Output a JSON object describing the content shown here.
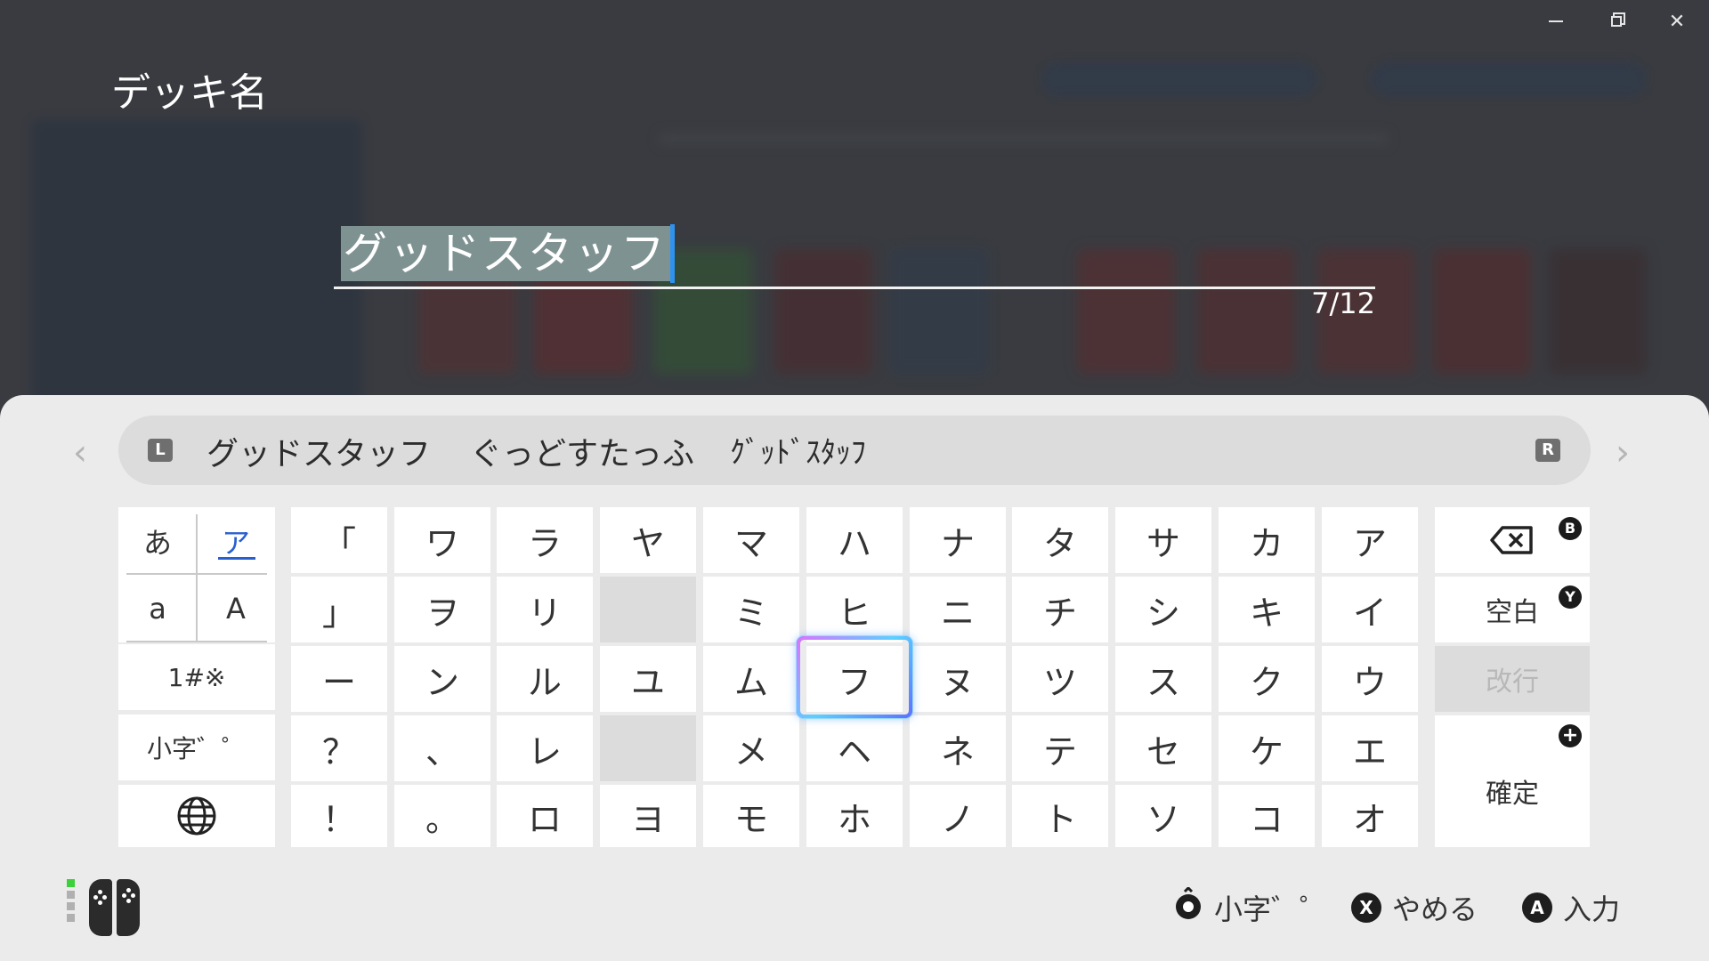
{
  "window": {
    "minimize_label": "minimize",
    "restore_label": "restore",
    "close_label": "close"
  },
  "header": {
    "title": "デッキ名"
  },
  "input": {
    "value": "グッドスタッフ",
    "counter": "7/12"
  },
  "predictions": {
    "left_badge": "L",
    "right_badge": "R",
    "items": [
      "グッドスタッフ",
      "ぐっどすたっふ",
      "ｸﾞｯﾄﾞｽﾀｯﾌ"
    ]
  },
  "modes": {
    "hiragana": "あ",
    "katakana": "ア",
    "lower_alpha": "a",
    "upper_alpha": "A",
    "symbols": "1#※",
    "small_dakuten": "小字゛゜"
  },
  "keys": {
    "row1": [
      "「",
      "ワ",
      "ラ",
      "ヤ",
      "マ",
      "ハ",
      "ナ",
      "タ",
      "サ",
      "カ",
      "ア"
    ],
    "row2": [
      "」",
      "ヲ",
      "リ",
      "",
      "ミ",
      "ヒ",
      "ニ",
      "チ",
      "シ",
      "キ",
      "イ"
    ],
    "row3": [
      "ー",
      "ン",
      "ル",
      "ユ",
      "ム",
      "フ",
      "ヌ",
      "ツ",
      "ス",
      "ク",
      "ウ"
    ],
    "row4": [
      "？",
      "、",
      "レ",
      "",
      "メ",
      "ヘ",
      "ネ",
      "テ",
      "セ",
      "ケ",
      "エ"
    ],
    "row5": [
      "！",
      "。",
      "ロ",
      "ヨ",
      "モ",
      "ホ",
      "ノ",
      "ト",
      "ソ",
      "コ",
      "オ"
    ]
  },
  "selected_key": "フ",
  "actions": {
    "space": "空白",
    "newline": "改行",
    "confirm": "確定",
    "backspace_button": "B",
    "space_button": "Y",
    "confirm_button": "+"
  },
  "footer": {
    "stick_label": "小字゛゜",
    "cancel_button": "X",
    "cancel_label": "やめる",
    "enter_button": "A",
    "enter_label": "入力"
  },
  "colors": {
    "sheet_bg": "#ebebeb",
    "key_bg": "#ffffff",
    "accent": "#2e93f0",
    "selection_bg": "#7f9292"
  }
}
